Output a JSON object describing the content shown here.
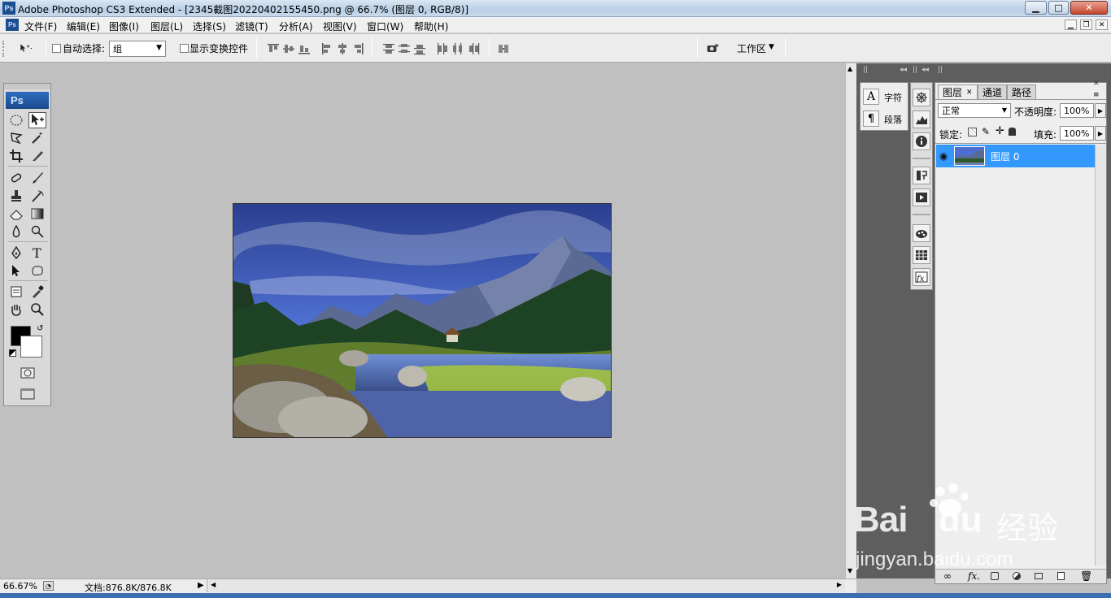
{
  "titlebar": {
    "title": "Adobe Photoshop CS3 Extended - [2345截图20220402155450.png @ 66.7% (图层 0, RGB/8)]",
    "app_icon": "Ps"
  },
  "menu": {
    "items": [
      "文件(F)",
      "编辑(E)",
      "图像(I)",
      "图层(L)",
      "选择(S)",
      "滤镜(T)",
      "分析(A)",
      "视图(V)",
      "窗口(W)",
      "帮助(H)"
    ]
  },
  "options": {
    "auto_select_label": "自动选择:",
    "auto_select_value": "组",
    "show_transform_label": "显示变换控件",
    "workspace_label": "工作区"
  },
  "toolbox": {
    "logo": "Ps"
  },
  "status": {
    "zoom": "66.67%",
    "doc_info": "文档:876.8K/876.8K"
  },
  "char_panel": {
    "char_label": "字符",
    "para_label": "段落"
  },
  "layers_panel": {
    "tabs": [
      "图层",
      "通道",
      "路径"
    ],
    "blend_mode": "正常",
    "opacity_label": "不透明度:",
    "opacity_value": "100%",
    "lock_label": "锁定:",
    "fill_label": "填充:",
    "fill_value": "100%",
    "layer_name": "图层 0",
    "bottom_fx": "fx."
  },
  "watermark": {
    "brand": "Bai",
    "brand2": "du",
    "cn": "经验",
    "url": "jingyan.baidu.com"
  },
  "colors": {
    "accent": "#3399ff",
    "foreground_swatch": "#000000",
    "background_swatch": "#ffffff"
  }
}
